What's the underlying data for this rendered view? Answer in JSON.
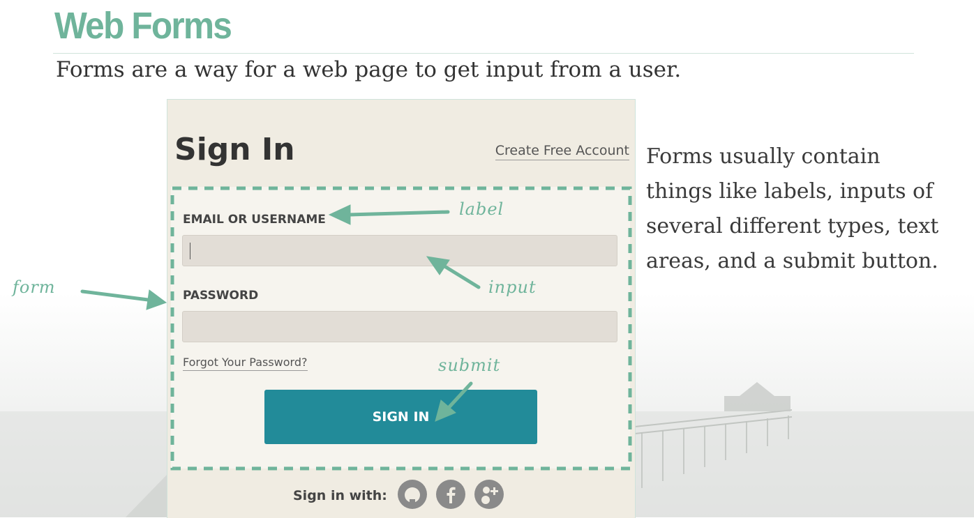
{
  "slide": {
    "title": "Web Forms",
    "subtitle": "Forms are a way for a web page to get input from a user.",
    "side_text": [
      "Forms usually contain",
      "things like labels, inputs of",
      "several different types, text",
      "areas, and a submit button."
    ]
  },
  "signin": {
    "title": "Sign In",
    "create_account": "Create Free Account",
    "email_label": "EMAIL OR USERNAME",
    "email_value": "",
    "password_label": "PASSWORD",
    "password_value": "",
    "forgot_link": "Forgot Your Password?",
    "submit_label": "SIGN IN",
    "signin_with": "Sign in with:",
    "social": [
      "github-icon",
      "facebook-icon",
      "google-plus-icon"
    ]
  },
  "annotations": {
    "label": "label",
    "input": "input",
    "form": "form",
    "submit": "submit"
  },
  "colors": {
    "accent": "#6fb49b",
    "button": "#228b99",
    "panel": "#f0ece2"
  }
}
